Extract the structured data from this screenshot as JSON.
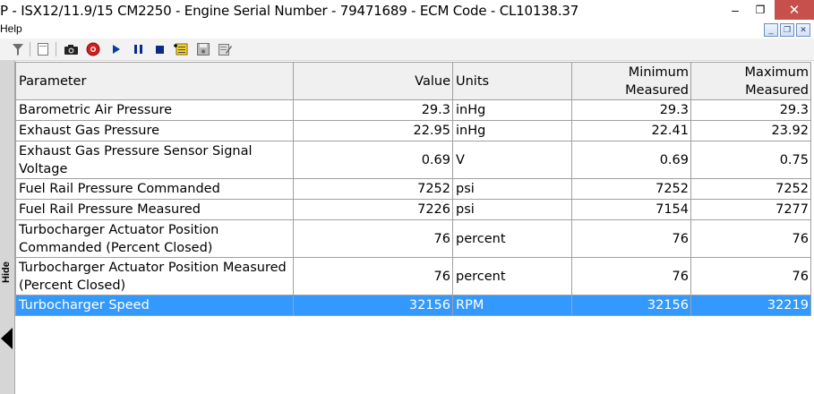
{
  "window": {
    "title": "P - ISX12/11.9/15 CM2250 - Engine Serial Number - 79471689 - ECM Code - CL10138.37",
    "minimize_glyph": "–",
    "restore_glyph": "❐",
    "close_glyph": "✕"
  },
  "menu": {
    "help_label": "Help",
    "mdi_minimize": "_",
    "mdi_restore": "❐",
    "mdi_close": "✕"
  },
  "toolbar": {
    "icons": [
      "filter-icon",
      "page-icon",
      "camera-icon",
      "record-icon",
      "play-icon",
      "pause-icon",
      "stop-icon",
      "add-parameter-icon",
      "save-icon",
      "edit-icon"
    ],
    "colors": {
      "record": "#d01f1f",
      "play": "#0a3ea5",
      "pause": "#0a2a8a",
      "stop": "#0a2a8a"
    }
  },
  "sidebar": {
    "hide_label": "Hide"
  },
  "table": {
    "headers": {
      "parameter": "Parameter",
      "value": "Value",
      "units": "Units",
      "min_line1": "Minimum",
      "min_line2": "Measured",
      "max_line1": "Maximum",
      "max_line2": "Measured"
    },
    "rows": [
      {
        "parameter": "Barometric Air Pressure",
        "value": "29.3",
        "units": "inHg",
        "min": "29.3",
        "max": "29.3"
      },
      {
        "parameter": "Exhaust Gas Pressure",
        "value": "22.95",
        "units": "inHg",
        "min": "22.41",
        "max": "23.92"
      },
      {
        "parameter": "Exhaust Gas Pressure Sensor Signal Voltage",
        "value": "0.69",
        "units": "V",
        "min": "0.69",
        "max": "0.75"
      },
      {
        "parameter": "Fuel Rail Pressure Commanded",
        "value": "7252",
        "units": "psi",
        "min": "7252",
        "max": "7252"
      },
      {
        "parameter": "Fuel Rail Pressure Measured",
        "value": "7226",
        "units": "psi",
        "min": "7154",
        "max": "7277"
      },
      {
        "parameter": "Turbocharger Actuator Position Commanded  (Percent Closed)",
        "value": "76",
        "units": "percent",
        "min": "76",
        "max": "76"
      },
      {
        "parameter": "Turbocharger Actuator Position Measured (Percent Closed)",
        "value": "76",
        "units": "percent",
        "min": "76",
        "max": "76"
      },
      {
        "parameter": "Turbocharger Speed",
        "value": "32156",
        "units": "RPM",
        "min": "32156",
        "max": "32219"
      }
    ],
    "selected_row_color": "#3399ff"
  }
}
